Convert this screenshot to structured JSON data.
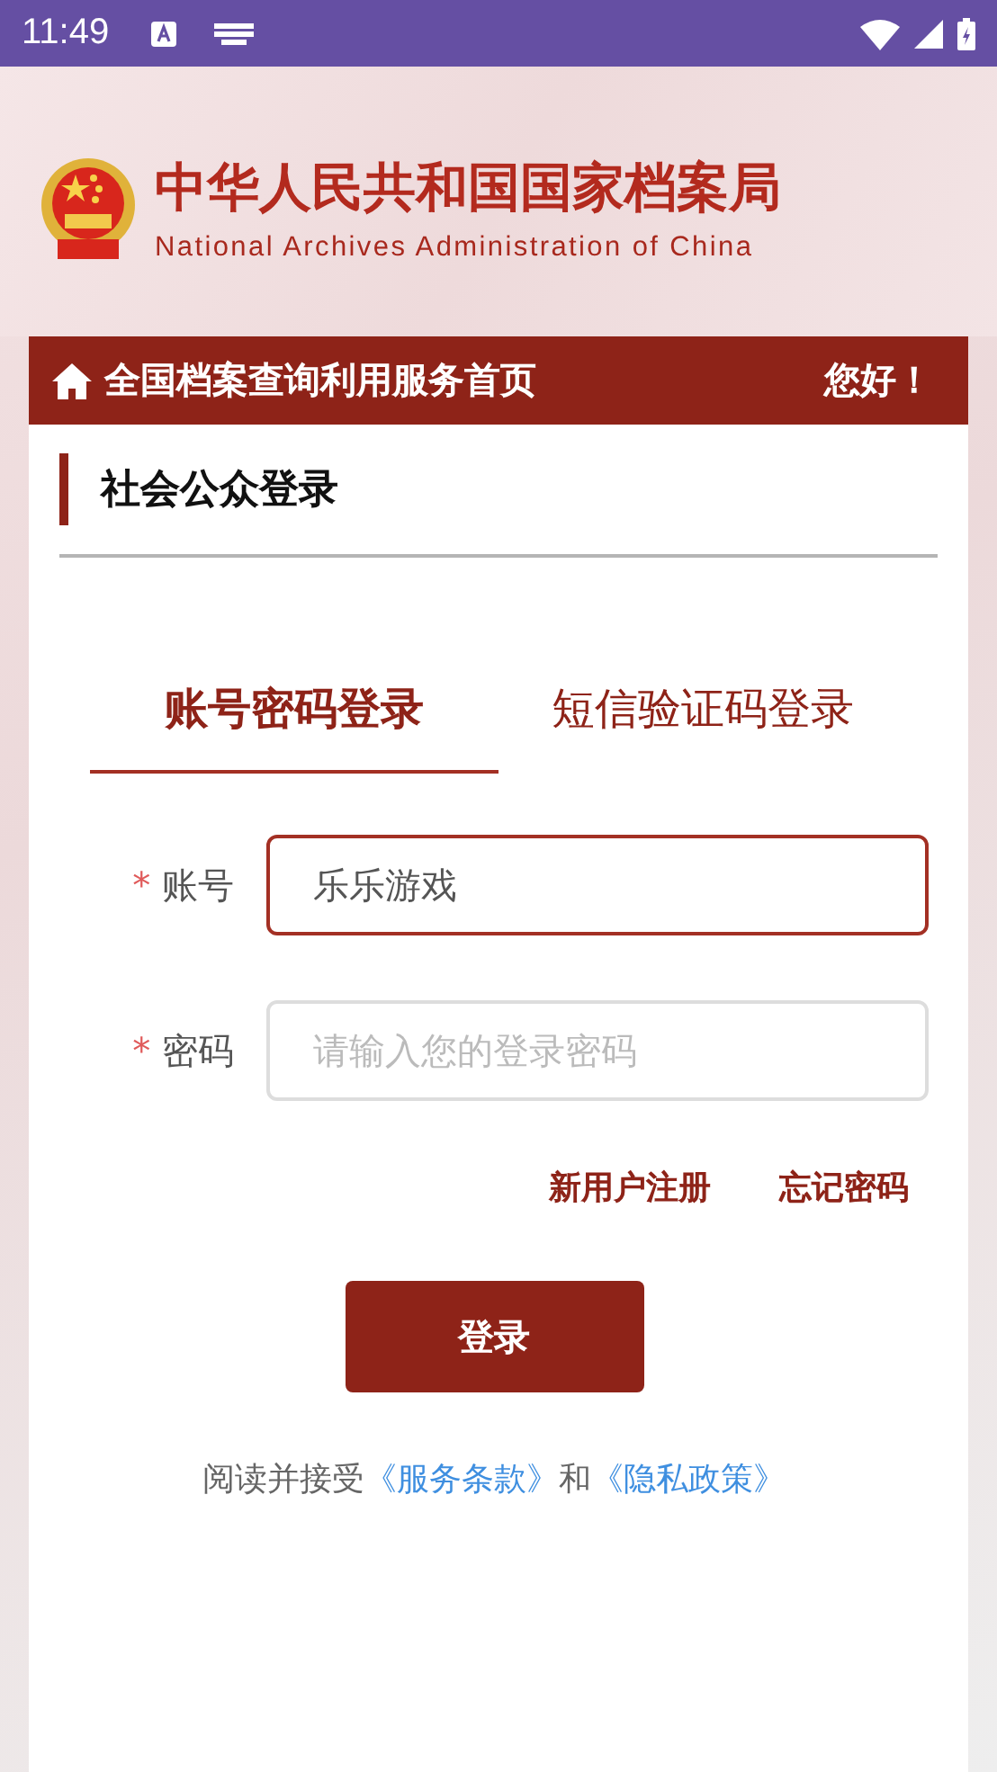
{
  "status_bar": {
    "time": "11:49"
  },
  "header": {
    "title": "中华人民共和国国家档案局",
    "subtitle": "National Archives Administration of China"
  },
  "nav_bar": {
    "title": "全国档案查询利用服务首页",
    "greeting": "您好！"
  },
  "section": {
    "title": "社会公众登录"
  },
  "tabs": [
    {
      "label": "账号密码登录",
      "selected": true
    },
    {
      "label": "短信验证码登录",
      "selected": false
    }
  ],
  "fields": [
    {
      "label": "账号",
      "required_mark": "*",
      "value": "乐乐游戏",
      "focused": true
    },
    {
      "label": "密码",
      "required_mark": "*",
      "placeholder": "请输入您的登录密码",
      "focused": false
    }
  ],
  "links": [
    "新用户注册",
    "忘记密码"
  ],
  "login_button": "登录",
  "agreement": {
    "text": "阅读并接受",
    "link1": "《服务条款》",
    "joiner": "和",
    "link2": "《隐私政策》"
  }
}
